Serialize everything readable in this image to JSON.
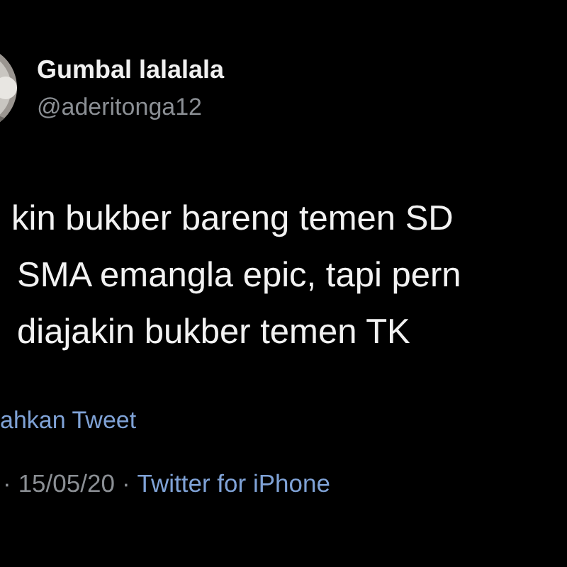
{
  "author": {
    "name": "Gumbal lalalala",
    "handle": "@aderitonga12"
  },
  "tweet": {
    "lines": [
      "kin bukber bareng temen SD",
      "SMA emangla epic, tapi pern",
      "diajakin bukber temen TK"
    ]
  },
  "translate_link": "ahkan Tweet",
  "meta": {
    "separator": "·",
    "date": "15/05/20",
    "source": "Twitter for iPhone"
  }
}
